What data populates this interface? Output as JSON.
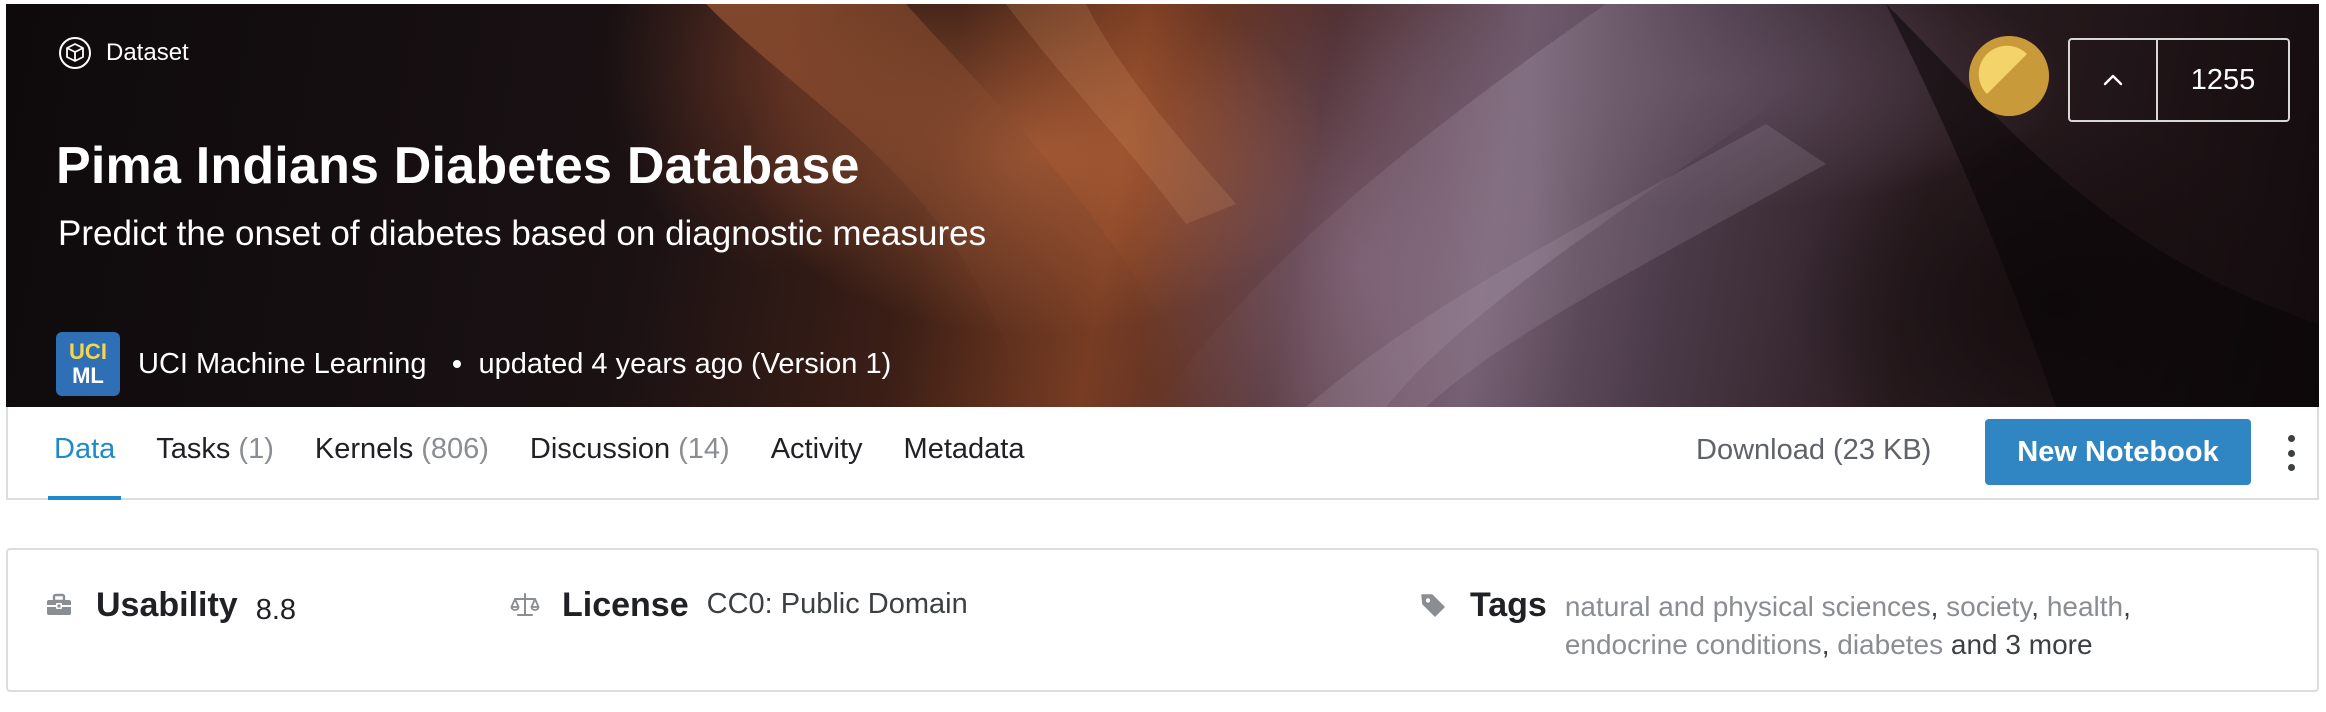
{
  "hero": {
    "kicker": {
      "label": "Dataset",
      "icon": "dataset-cube-icon"
    },
    "title": "Pima Indians Diabetes Database",
    "subtitle": "Predict the onset of diabetes based on diagnostic measures",
    "owner": {
      "avatar_line1": "UCI",
      "avatar_line2": "ML",
      "name": "UCI Machine Learning"
    },
    "updated": "updated 4 years ago (Version 1)",
    "medal": {
      "icon": "gold-medal-icon",
      "color": "#c99a3a"
    },
    "vote": {
      "icon": "chevron-up-icon",
      "count": "1255"
    }
  },
  "tabs": [
    {
      "label": "Data",
      "count": "",
      "active": true
    },
    {
      "label": "Tasks",
      "count": "(1)"
    },
    {
      "label": "Kernels",
      "count": "(806)"
    },
    {
      "label": "Discussion",
      "count": "(14)"
    },
    {
      "label": "Activity",
      "count": ""
    },
    {
      "label": "Metadata",
      "count": ""
    }
  ],
  "actions": {
    "download_label": "Download (23 KB)",
    "new_notebook_label": "New Notebook",
    "more_icon": "kebab-menu-icon"
  },
  "info": {
    "usability": {
      "label": "Usability",
      "value": "8.8",
      "icon": "toolbox-icon"
    },
    "license": {
      "label": "License",
      "value": "CC0: Public Domain",
      "icon": "scales-icon"
    },
    "tags": {
      "label": "Tags",
      "icon": "tag-icon",
      "items": [
        "natural and physical sciences",
        "society",
        "health",
        "endocrine conditions",
        "diabetes"
      ],
      "separator": ",",
      "more": "and 3 more"
    }
  },
  "colors": {
    "accent": "#1f8acb",
    "button": "#2f86c2",
    "avatar_bg": "#2f6fb5",
    "avatar_text": "#f7d54a"
  }
}
